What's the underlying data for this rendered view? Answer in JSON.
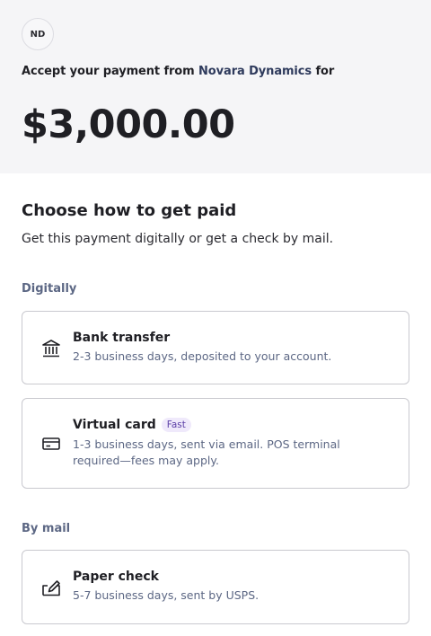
{
  "header": {
    "avatar_initials": "ND",
    "accept_prefix": "Accept your payment from",
    "payer_name": "Novara Dynamics",
    "accept_suffix": "for",
    "amount": "$3,000.00"
  },
  "main": {
    "title": "Choose how to get paid",
    "subtitle": "Get this payment digitally or get a check by mail."
  },
  "sections": {
    "digital_label": "Digitally",
    "mail_label": "By mail"
  },
  "options": {
    "bank": {
      "name": "Bank transfer",
      "description": "2-3 business days, deposited to your account.",
      "icon": "bank-icon"
    },
    "virtual_card": {
      "name": "Virtual card",
      "badge": "Fast",
      "description": "1-3 business days, sent via email. POS terminal required—fees may apply.",
      "icon": "credit-card-icon"
    },
    "paper_check": {
      "name": "Paper check",
      "description": "5-7 business days, sent by USPS.",
      "icon": "check-sign-icon"
    }
  },
  "colors": {
    "header_bg": "#f5f5f7",
    "accent_badge_bg": "#efe9fb",
    "accent_badge_text": "#5b3fa6",
    "muted_text": "#5c6784"
  }
}
